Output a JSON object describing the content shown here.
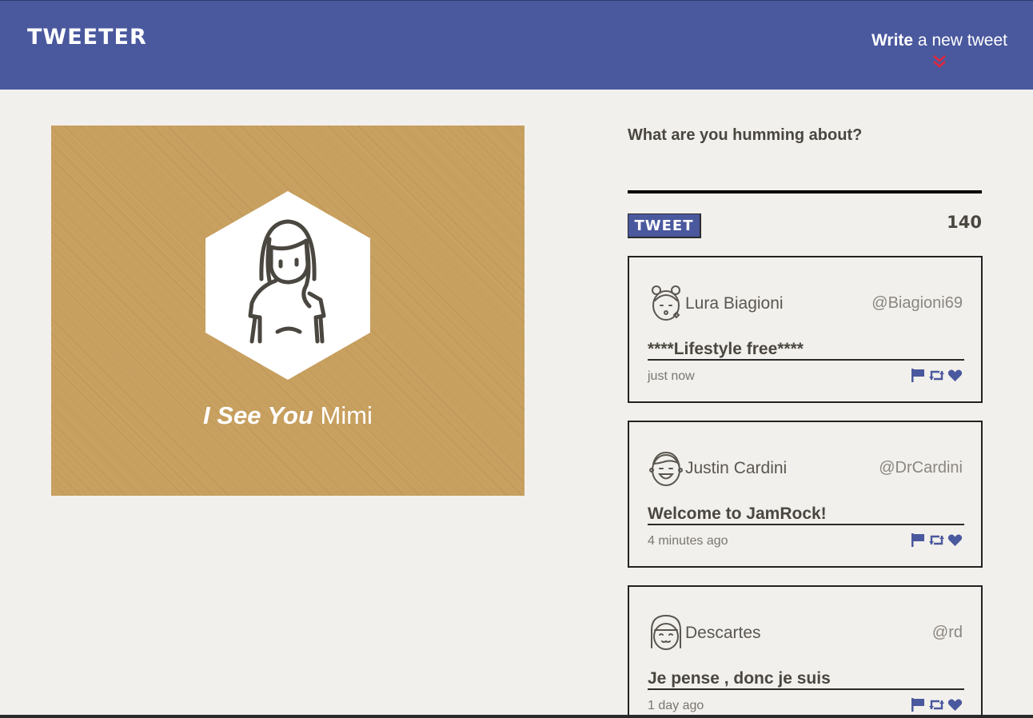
{
  "header": {
    "brand": "TWEETER",
    "compose_bold": "Write",
    "compose_rest": " a new tweet",
    "compose_icon": "double-chevron-down-icon"
  },
  "profile": {
    "name_italic": "I See You",
    "name_rest": " Mimi",
    "avatar_icon": "girl-avatar-icon",
    "background_color": "#c79f5e"
  },
  "composer": {
    "prompt": "What are you humming about?",
    "input_value": "",
    "button_label": "TWEET",
    "counter": "140"
  },
  "tweets": [
    {
      "name": "Lura Biagioni",
      "handle": "@Biagioni69",
      "text": "****Lifestyle free****",
      "time": "just now",
      "avatar_icon": "girl-buns-avatar-icon"
    },
    {
      "name": "Justin Cardini",
      "handle": "@DrCardini",
      "text": "Welcome to JamRock!",
      "time": "4 minutes ago",
      "avatar_icon": "boy-avatar-icon"
    },
    {
      "name": "Descartes",
      "handle": "@rd",
      "text": "Je pense , donc je suis",
      "time": "1 day ago",
      "avatar_icon": "bob-hair-avatar-icon"
    }
  ],
  "colors": {
    "header_bg": "#4a589e",
    "accent_red": "#e0283c",
    "icon_blue": "#4a589e",
    "page_bg": "#f2f0ec"
  }
}
